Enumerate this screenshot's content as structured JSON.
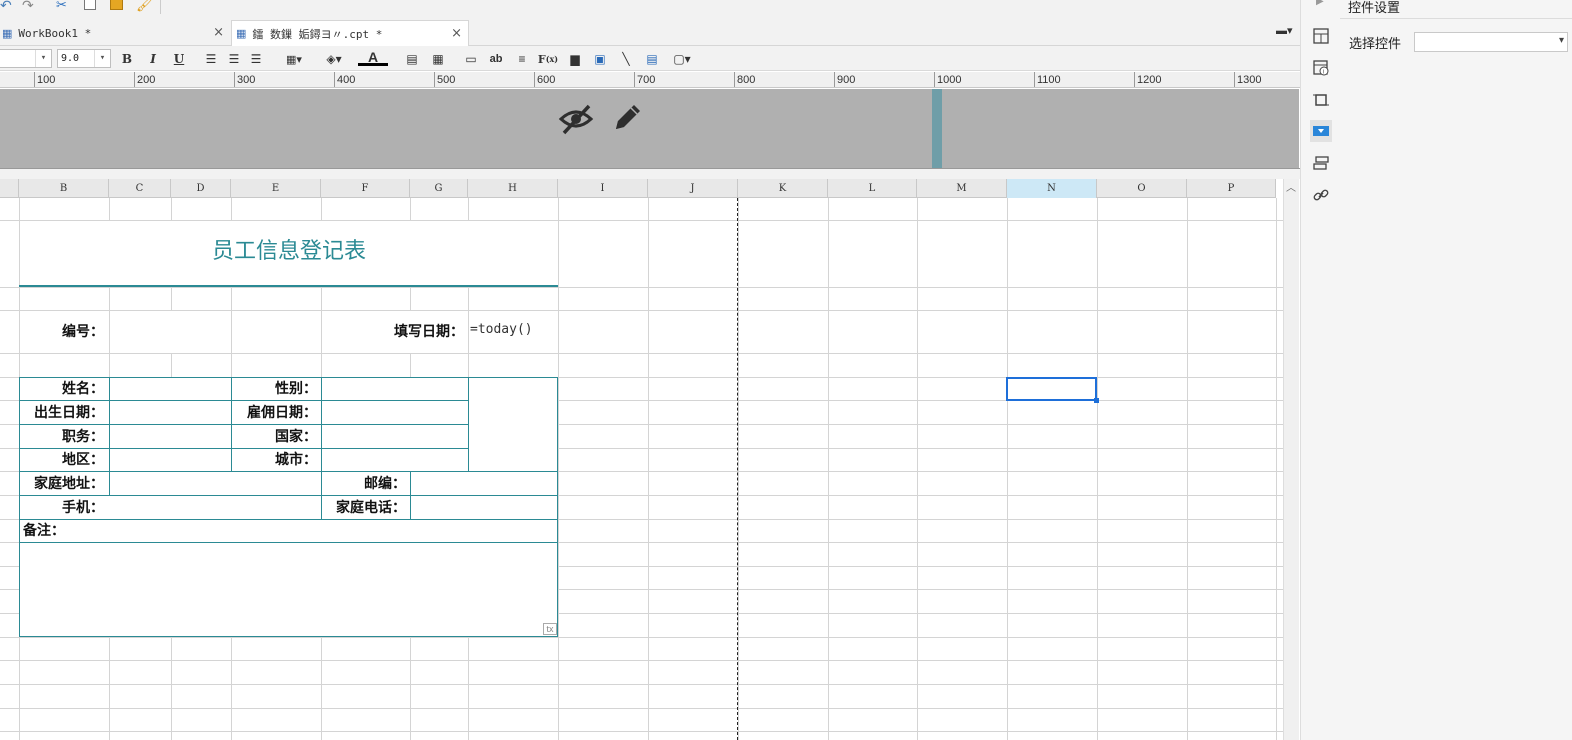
{
  "tabs": [
    {
      "label": "WorkBook1 *"
    },
    {
      "label": "鐳  数鏁  姤鐞ヨ〃.cpt *"
    }
  ],
  "format": {
    "font_name": "",
    "font_size": "9.0"
  },
  "ruler": [
    "100",
    "200",
    "300",
    "400",
    "500",
    "600",
    "700",
    "800",
    "900",
    "1000",
    "1100",
    "1200",
    "1300"
  ],
  "columns": [
    "B",
    "C",
    "D",
    "E",
    "F",
    "G",
    "H",
    "I",
    "J",
    "K",
    "L",
    "M",
    "N",
    "O",
    "P"
  ],
  "selected_column": "N",
  "report": {
    "title": "员工信息登记表",
    "number_label": "编号：",
    "date_label": "填写日期：",
    "date_formula": "=today()",
    "name_label": "姓名：",
    "gender_label": "性别：",
    "birth_label": "出生日期：",
    "hire_label": "雇佣日期：",
    "position_label": "职务：",
    "country_label": "国家：",
    "region_label": "地区：",
    "city_label": "城市：",
    "address_label": "家庭地址：",
    "zip_label": "邮编：",
    "mobile_label": "手机：",
    "home_phone_label": "家庭电话：",
    "remarks_label": "备注：",
    "tx_badge": "tx"
  },
  "props": {
    "title": "控件设置",
    "select_label": "选择控件",
    "select_value": ""
  },
  "colors": {
    "accent": "#2b8a94",
    "selection": "#1e6fd9"
  }
}
